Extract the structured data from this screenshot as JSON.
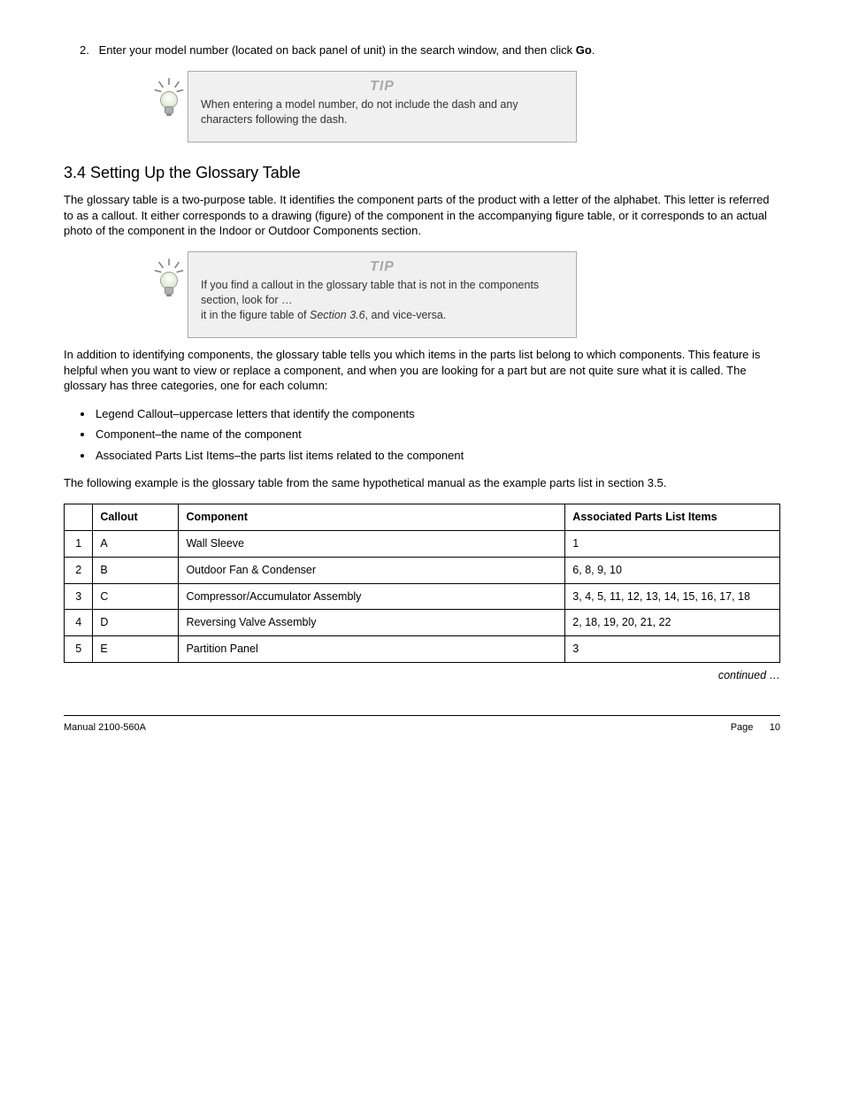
{
  "intro": {
    "step_num": "2.",
    "step_text_1": "Enter your model number (located on back panel of unit) in the search window, and then click ",
    "step_go": "Go",
    "step_text_2": "."
  },
  "tip1": {
    "label": "TIP",
    "body": "When entering a model number, do not include the dash and any characters following the dash."
  },
  "section_heading": "3.4 Setting Up the Glossary Table",
  "glossary_intro_1": "The glossary table is a two-purpose table. It identifies the component parts of the product with a letter of the alphabet. This letter is referred to as a callout. It either corresponds to a drawing (figure) of the component in the accompanying figure table, or it corresponds to an actual photo of the component in the Indoor or Outdoor Components section.",
  "tip2": {
    "label": "TIP",
    "body_1": "If you find a callout in the glossary table that is not in the components section, look for … ",
    "body_2_prefix": "it in the figure table of ",
    "body_2_em": "Section 3.6",
    "body_2_suffix": ", and vice-versa."
  },
  "glossary_intro_2": "In addition to identifying components, the glossary table tells you which items in the parts list belong to which components. This feature is helpful when you want to view or replace a component, and when you are looking for a part but are not quite sure what it is called. The glossary has three categories, one for each column:",
  "categories": [
    "Legend Callout–uppercase letters that identify the components",
    "Component–the name of the component",
    "Associated Parts List Items–the parts list items related to the component"
  ],
  "example_intro": "The following example is the glossary table from the same hypothetical manual as the example parts list in section 3.5.",
  "table": {
    "headers": [
      "",
      "Callout",
      "Component",
      "Associated Parts List Items"
    ],
    "rows": [
      {
        "num": "1",
        "callout": "A",
        "component": "Wall Sleeve",
        "parts": "1"
      },
      {
        "num": "2",
        "callout": "B",
        "component": "Outdoor Fan & Condenser",
        "parts": "6, 8, 9, 10"
      },
      {
        "num": "3",
        "callout": "C",
        "component": "Compressor/Accumulator Assembly",
        "parts": "3, 4, 5, 11, 12, 13, 14, 15, 16, 17, 18"
      },
      {
        "num": "4",
        "callout": "D",
        "component": "Reversing Valve Assembly",
        "parts": "2, 18, 19, 20, 21, 22"
      },
      {
        "num": "5",
        "callout": "E",
        "component": "Partition Panel",
        "parts": "3"
      }
    ]
  },
  "continued": "continued …",
  "footer": {
    "left": "Manual 2100-560A",
    "right_label": "Page",
    "right_page": "10"
  }
}
